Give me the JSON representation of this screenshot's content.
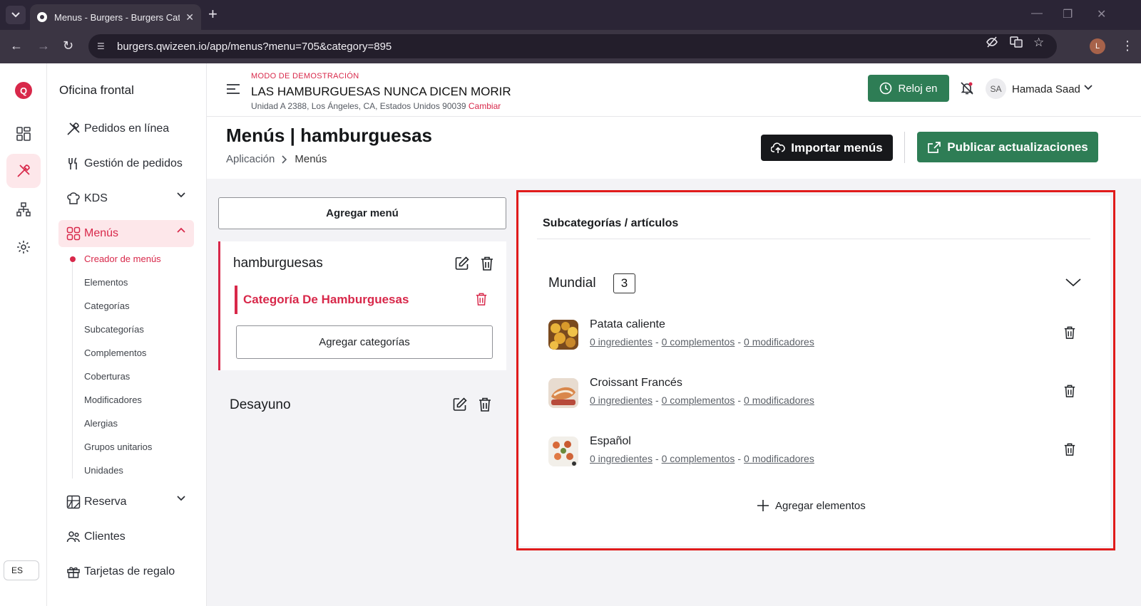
{
  "browser": {
    "tab_title": "Menus - Burgers - Burgers Cate",
    "url": "burgers.qwizeen.io/app/menus?menu=705&category=895",
    "profile_initial": "L"
  },
  "rail": {
    "logo": "Q",
    "language": "ES"
  },
  "sidebar": {
    "title": "Oficina frontal",
    "items": [
      {
        "label": "Pedidos en línea"
      },
      {
        "label": "Gestión de pedidos"
      },
      {
        "label": "KDS"
      },
      {
        "label": "Menús"
      },
      {
        "label": "Reserva"
      },
      {
        "label": "Clientes"
      },
      {
        "label": "Tarjetas de regalo"
      }
    ],
    "sub_items": [
      "Creador de menús",
      "Elementos",
      "Categorías",
      "Subcategorías",
      "Complementos",
      "Coberturas",
      "Modificadores",
      "Alergias",
      "Grupos unitarios",
      "Unidades"
    ]
  },
  "topbar": {
    "demo_label": "MODO DE DEMOSTRACIÓN",
    "restaurant_name": "LAS HAMBURGUESAS NUNCA DICEN MORIR",
    "address": "Unidad A 2388, Los Ángeles, CA, Estados Unidos 90039",
    "change_label": "Cambiar",
    "clock_in_label": "Reloj en",
    "user_initials": "SA",
    "user_name": "Hamada Saad"
  },
  "page": {
    "title": "Menús | hamburguesas",
    "breadcrumb": [
      "Aplicación",
      "Menús"
    ],
    "import_label": "Importar menús",
    "publish_label": "Publicar actualizaciones"
  },
  "menus": {
    "add_menu_label": "Agregar menú",
    "add_category_label": "Agregar categorías",
    "list": [
      {
        "name": "hamburguesas",
        "categories": [
          "Categoría De Hamburguesas"
        ]
      },
      {
        "name": "Desayuno"
      }
    ]
  },
  "panel": {
    "title": "Subcategorías / artículos",
    "group": {
      "name": "Mundial",
      "count": "3"
    },
    "items": [
      {
        "name": "Patata caliente",
        "ingredients": "0 ingredientes",
        "complements": "0 complementos",
        "modifiers": "0 modificadores"
      },
      {
        "name": "Croissant Francés",
        "ingredients": "0 ingredientes",
        "complements": "0 complementos",
        "modifiers": "0 modificadores"
      },
      {
        "name": "Español",
        "ingredients": "0 ingredientes",
        "complements": "0 complementos",
        "modifiers": "0 modificadores"
      }
    ],
    "separator": "-",
    "add_items_label": "Agregar elementos"
  },
  "colors": {
    "brand": "#d8284a",
    "green": "#2e7d55",
    "highlight": "#e01b1b"
  }
}
